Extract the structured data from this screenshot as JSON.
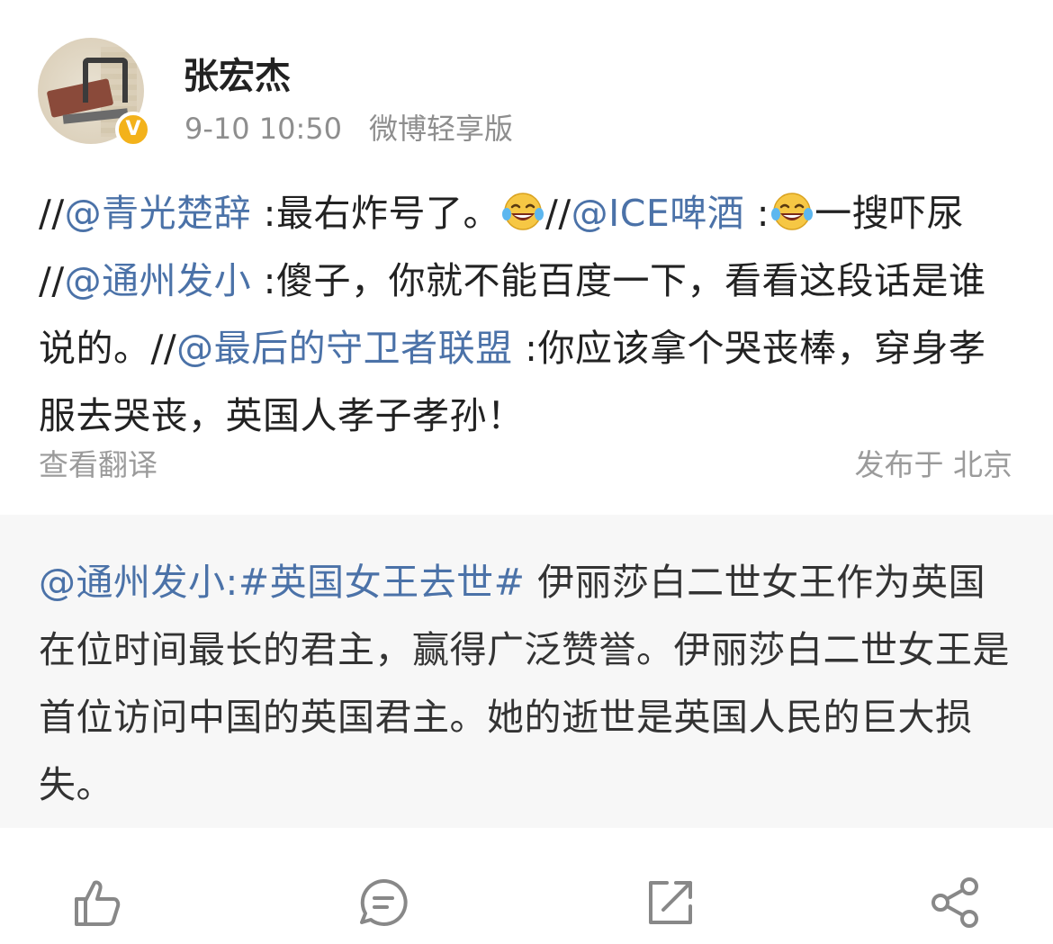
{
  "post": {
    "username": "张宏杰",
    "time": "9-10 10:50",
    "source": "微博轻享版",
    "verified_badge": "V",
    "segments": [
      {
        "t": "//",
        "m": false
      },
      {
        "t": "@青光楚辞",
        "m": true
      },
      {
        "t": " :最右炸号了。",
        "m": false
      },
      {
        "e": "laughing-crying"
      },
      {
        "t": "//",
        "m": false
      },
      {
        "t": "@ICE啤酒",
        "m": true
      },
      {
        "t": " :",
        "m": false
      },
      {
        "e": "laughing-crying"
      },
      {
        "t": "一搜吓尿 //",
        "m": false
      },
      {
        "t": "@通州发小",
        "m": true
      },
      {
        "t": " :傻子，你就不能百度一下，看看这段话是谁说的。//",
        "m": false
      },
      {
        "t": "@最后的守卫者联盟",
        "m": true
      },
      {
        "t": " :你应该拿个哭丧棒，穿身孝服去哭丧，英国人孝子孝孙！",
        "m": false
      }
    ],
    "translate_label": "查看翻译",
    "location_label": "发布于 北京"
  },
  "quote": {
    "segments": [
      {
        "t": "@通州发小:",
        "m": true
      },
      {
        "t": "#英国女王去世#",
        "m": true
      },
      {
        "t": " 伊丽莎白二世女王作为英国在位时间最长的君主，赢得广泛赞誉。伊丽莎白二世女王是首位访问中国的英国君主。她的逝世是英国人民的巨大损失。",
        "m": false
      }
    ]
  },
  "actions": {
    "icons": [
      "like-icon",
      "comment-icon",
      "repost-icon",
      "share-icon"
    ]
  },
  "colors": {
    "mention": "#4b72a8",
    "meta": "#8e8e8e",
    "quote_bg": "#f7f7f7",
    "badge": "#f3b21b"
  }
}
